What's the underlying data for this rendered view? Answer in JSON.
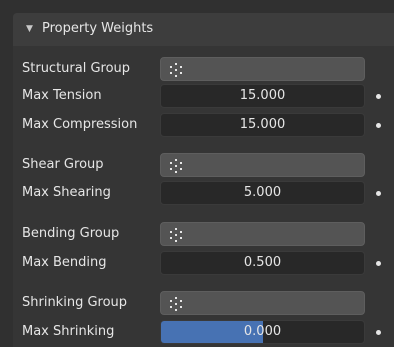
{
  "panel": {
    "title": "Property Weights"
  },
  "structural": {
    "group_label": "Structural Group",
    "max_label": "Max Tension",
    "max_value": "15.000",
    "max2_label": "Max Compression",
    "max2_value": "15.000"
  },
  "shear": {
    "group_label": "Shear Group",
    "max_label": "Max Shearing",
    "max_value": "5.000"
  },
  "bending": {
    "group_label": "Bending Group",
    "max_label": "Max Bending",
    "max_value": "0.500"
  },
  "shrinking": {
    "group_label": "Shrinking Group",
    "max_label": "Max Shrinking",
    "max_value": "0.000",
    "fill_fraction": 0.5
  },
  "icons": {
    "group_field": "vertex-group-icon",
    "header": "disclosure-triangle-down-icon",
    "keyframe": "animate-property-dot-icon"
  },
  "colors": {
    "accent": "#4772b3",
    "panel_bg": "#353535",
    "field_bg": "#282828",
    "group_field_bg": "#545454"
  }
}
